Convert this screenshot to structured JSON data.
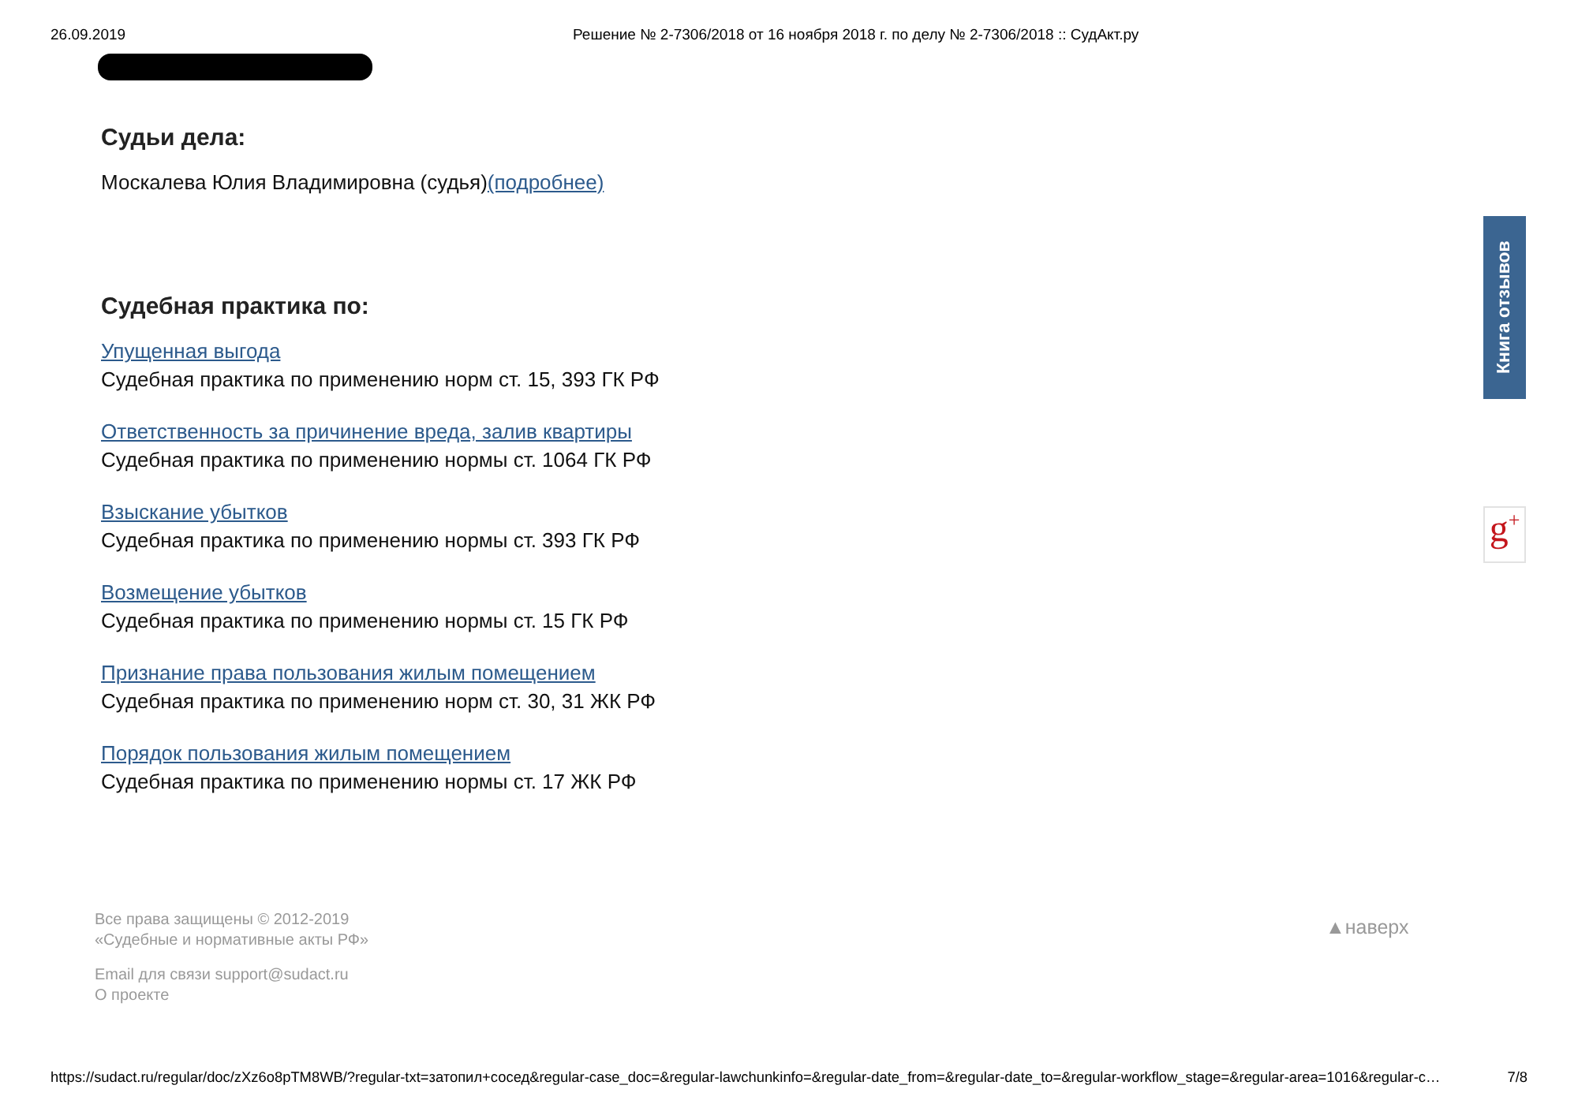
{
  "print_header": {
    "date": "26.09.2019",
    "title": "Решение № 2-7306/2018 от 16 ноября 2018 г. по делу № 2-7306/2018 :: СудАкт.ру"
  },
  "judges": {
    "heading": "Судьи дела:",
    "entries": [
      {
        "name": "Москалева Юлия Владимировна (судья)",
        "link": "(подробнее)"
      }
    ]
  },
  "practice": {
    "heading": "Судебная практика по:",
    "items": [
      {
        "link": "Упущенная выгода",
        "description": "Судебная практика по применению норм ст. 15, 393 ГК РФ"
      },
      {
        "link": "Ответственность за причинение вреда, залив квартиры",
        "description": "Судебная практика по применению нормы ст. 1064 ГК РФ"
      },
      {
        "link": "Взыскание убытков",
        "description": "Судебная практика по применению нормы ст. 393 ГК РФ"
      },
      {
        "link": "Возмещение убытков",
        "description": "Судебная практика по применению нормы ст. 15 ГК РФ"
      },
      {
        "link": "Признание права пользования жилым помещением",
        "description": "Судебная практика по применению норм ст. 30, 31 ЖК РФ"
      },
      {
        "link": "Порядок пользования жилым помещением",
        "description": "Судебная практика по применению нормы ст. 17 ЖК РФ"
      }
    ]
  },
  "side_tab": {
    "label": "Книга отзывов"
  },
  "share_button": {
    "label": "g$^{+}$"
  },
  "footer": {
    "copyright": [
      "Все права защищены © 2012-2019",
      "«Судебные и нормативные акты РФ»"
    ],
    "contact": "Email для связи support@sudact.ru",
    "about_link": "О проекте",
    "back_to_top": "▲наверх"
  },
  "print_footer": {
    "url": "https://sudact.ru/regular/doc/zXz6o8pTM8WB/?regular-txt=затопил+сосед&regular-case_doc=&regular-lawchunkinfo=&regular-date_from=&regular-date_to=&regular-workflow_stage=&regular-area=1016&regular-c…",
    "page": "7/8"
  }
}
